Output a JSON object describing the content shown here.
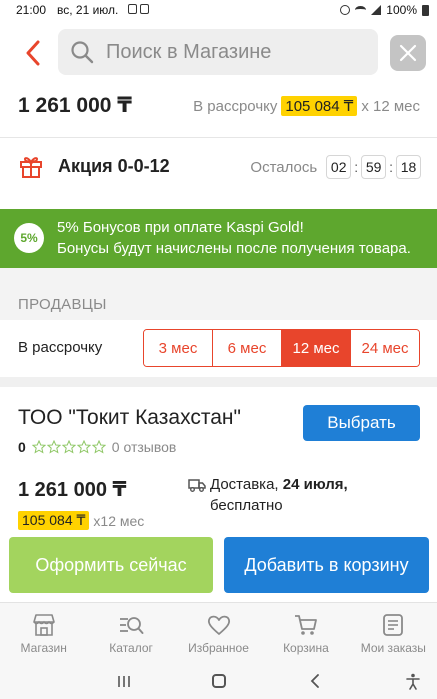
{
  "status_bar": {
    "time": "21:00",
    "date": "вс, 21 июл.",
    "battery": "100%"
  },
  "search": {
    "placeholder": "Поиск в Магазине"
  },
  "price": {
    "main": "1 261 000 ₸",
    "installment_label": "В рассрочку",
    "installment_amount": "105 084 ₸",
    "installment_term": "х 12 мес"
  },
  "promo": {
    "title": "Акция 0-0-12",
    "timer_label": "Осталось",
    "hours": "02",
    "minutes": "59",
    "seconds": "18"
  },
  "bonus": {
    "badge": "5%",
    "line1": "5% Бонусов при оплате Kaspi Gold!",
    "line2": "Бонусы будут начислены после получения товара."
  },
  "sellers": {
    "section_label": "ПРОДАВЦЫ",
    "installment_label": "В рассрочку",
    "terms": [
      {
        "label": "3 мес",
        "active": false
      },
      {
        "label": "6 мес",
        "active": false
      },
      {
        "label": "12 мес",
        "active": true
      },
      {
        "label": "24 мес",
        "active": false
      }
    ]
  },
  "seller": {
    "name": "ТОО \"Токит Казахстан\"",
    "select_label": "Выбрать",
    "rating": "0",
    "reviews": "0 отзывов",
    "price": "1 261 000 ₸",
    "installment_amount": "105 084 ₸",
    "installment_term": "x12 мес",
    "delivery_prefix": "Доставка,",
    "delivery_date": "24 июля,",
    "delivery_cost": "бесплатно"
  },
  "actions": {
    "order_label": "Оформить сейчас",
    "cart_label": "Добавить в корзину"
  },
  "bottom_nav": {
    "items": [
      {
        "label": "Магазин",
        "icon": "store-icon"
      },
      {
        "label": "Каталог",
        "icon": "catalog-search-icon"
      },
      {
        "label": "Избранное",
        "icon": "heart-icon"
      },
      {
        "label": "Корзина",
        "icon": "cart-icon"
      },
      {
        "label": "Мои заказы",
        "icon": "orders-icon"
      }
    ]
  },
  "colors": {
    "accent_red": "#e8452c",
    "brand_blue": "#1f7fd6",
    "bonus_green": "#5ea72e",
    "order_green": "#a3d45e",
    "highlight_yellow": "#ffd200"
  }
}
